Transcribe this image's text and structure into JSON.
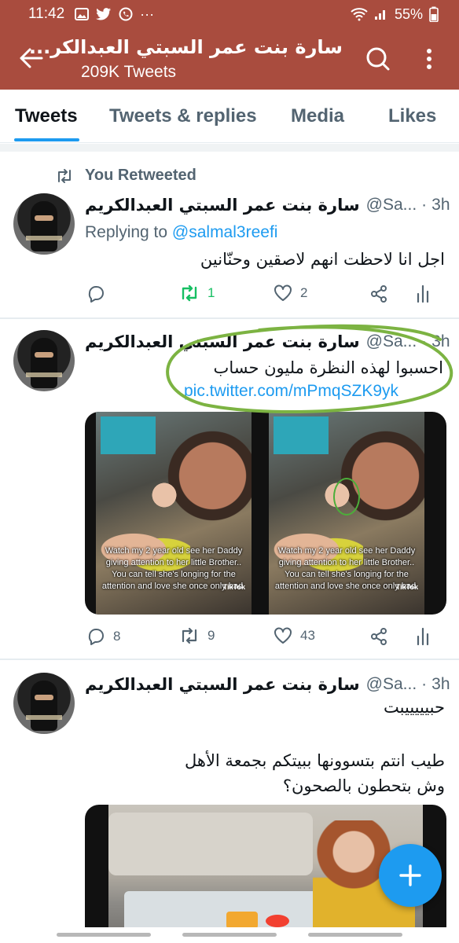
{
  "status_bar": {
    "time": "11:42",
    "battery": "55%",
    "dots": "···"
  },
  "header": {
    "title": "سارة بنت عمر السبتي العبدالكر...",
    "subtitle": "209K Tweets"
  },
  "tabs": [
    {
      "label": "Tweets",
      "active": true
    },
    {
      "label": "Tweets & replies",
      "active": false
    },
    {
      "label": "Media",
      "active": false
    },
    {
      "label": "Likes",
      "active": false
    }
  ],
  "tweets": [
    {
      "retweet_label": "You Retweeted",
      "display_name": "سارة بنت عمر السبتي العبدالكريم",
      "handle": "@Sa...",
      "time": "3h",
      "replying_prefix": "Replying to",
      "replying_to": "@salmal3reefi",
      "text": "اجل انا لاحظت انهم لاصقين وحنّانين",
      "replies": "",
      "retweets": "1",
      "likes": "2"
    },
    {
      "display_name": "سارة بنت عمر السبتي العبدالكريم",
      "handle": "@Sa...",
      "time": "3h",
      "text": "احسبوا لهذه النظرة مليون حساب",
      "link": "pic.twitter.com/mPmqSZK9yk",
      "video_caption": "Watch my 2 year old see her Daddy giving attention to her little Brother.. You can tell she's longing for the attention and love she once only had.",
      "video_brand": "TikTok",
      "replies": "8",
      "retweets": "9",
      "likes": "43"
    },
    {
      "display_name": "سارة بنت عمر السبتي العبدالكريم",
      "handle": "@Sa...",
      "time": "3h",
      "text_line1": "حبيييييبت",
      "text_line2": "طيب انتم بتسوونها ببيتكم بجمعة الأهل",
      "text_line3": "وش بتحطون بالصحون؟"
    }
  ],
  "colors": {
    "header": "#a94c3e",
    "accent": "#1d9bf0",
    "retweet_green": "#17bf63",
    "annotation_green": "#7cb342"
  }
}
